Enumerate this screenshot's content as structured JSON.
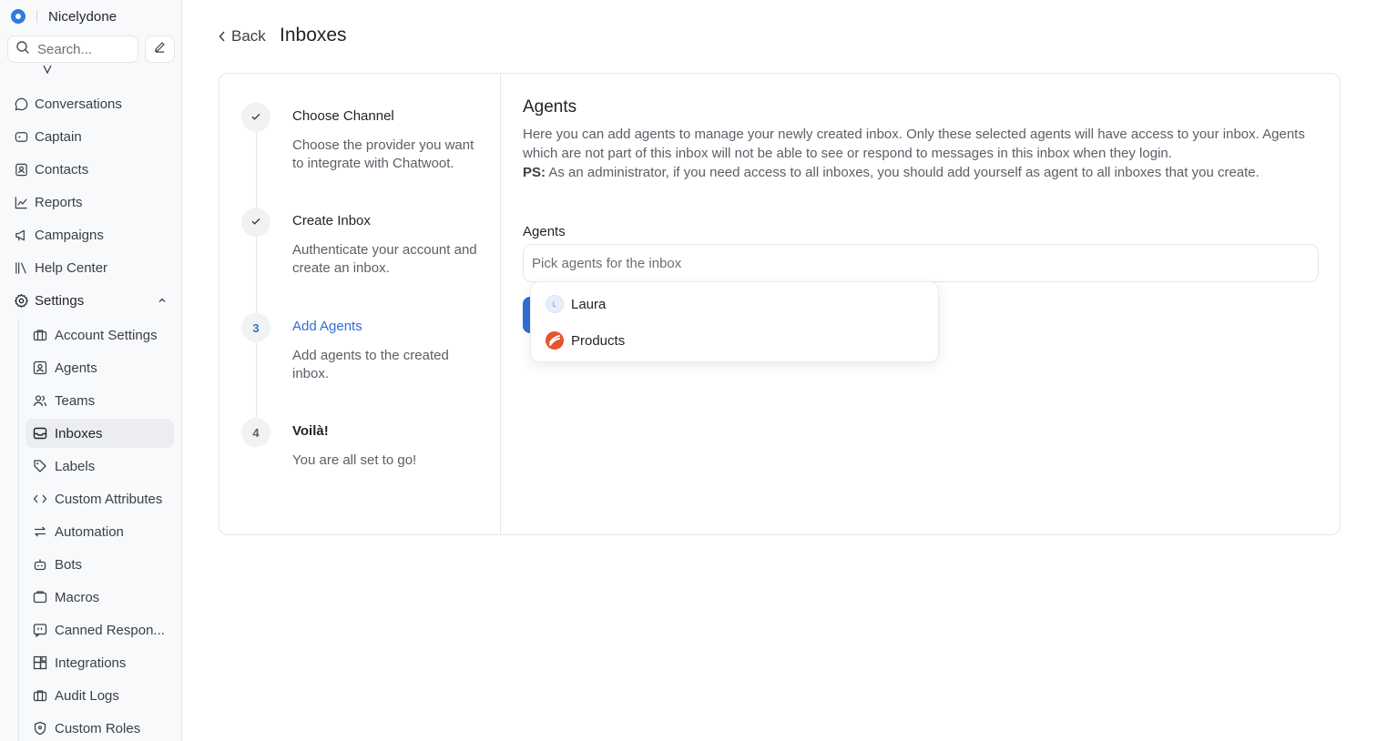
{
  "brand": {
    "name": "Nicelydone"
  },
  "search": {
    "placeholder": "Search..."
  },
  "nav": {
    "items": [
      {
        "label": "Conversations"
      },
      {
        "label": "Captain"
      },
      {
        "label": "Contacts"
      },
      {
        "label": "Reports"
      },
      {
        "label": "Campaigns"
      },
      {
        "label": "Help Center"
      },
      {
        "label": "Settings"
      }
    ],
    "settings_sub": [
      {
        "label": "Account Settings"
      },
      {
        "label": "Agents"
      },
      {
        "label": "Teams"
      },
      {
        "label": "Inboxes"
      },
      {
        "label": "Labels"
      },
      {
        "label": "Custom Attributes"
      },
      {
        "label": "Automation"
      },
      {
        "label": "Bots"
      },
      {
        "label": "Macros"
      },
      {
        "label": "Canned Respon..."
      },
      {
        "label": "Integrations"
      },
      {
        "label": "Audit Logs"
      },
      {
        "label": "Custom Roles"
      }
    ]
  },
  "header": {
    "back_label": "Back",
    "title": "Inboxes"
  },
  "steps": [
    {
      "marker": "",
      "title": "Choose Channel",
      "desc": "Choose the provider you want to integrate with Chatwoot."
    },
    {
      "marker": "",
      "title": "Create Inbox",
      "desc": "Authenticate your account and create an inbox."
    },
    {
      "marker": "3",
      "title": "Add Agents",
      "desc": "Add agents to the created inbox."
    },
    {
      "marker": "4",
      "title": "Voilà!",
      "desc": "You are all set to go!"
    }
  ],
  "content": {
    "title": "Agents",
    "desc": "Here you can add agents to manage your newly created inbox. Only these selected agents will have access to your inbox. Agents which are not part of this inbox will not be able to see or respond to messages in this inbox when they login.",
    "ps_label": "PS:",
    "ps_text": " As an administrator, if you need access to all inboxes, you should add yourself as agent to all inboxes that you create.",
    "field_label": "Agents",
    "input_placeholder": "Pick agents for the inbox"
  },
  "dropdown": {
    "options": [
      {
        "avatar": "L",
        "label": "Laura"
      },
      {
        "label": "Products"
      }
    ]
  },
  "colors": {
    "accent": "#2f6fd6",
    "brand": "#2f7be0"
  }
}
